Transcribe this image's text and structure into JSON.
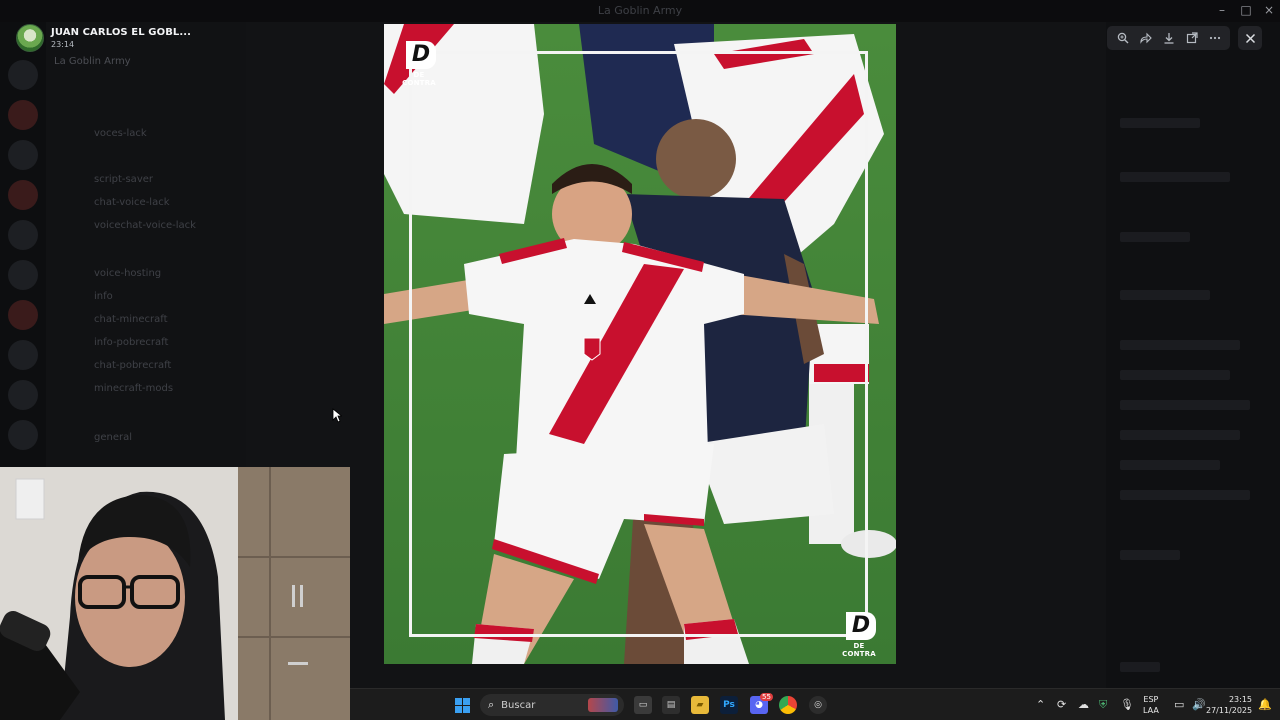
{
  "window": {
    "title": "La Goblin Army"
  },
  "viewer": {
    "user_name": "JUAN CARLOS EL GOBL...",
    "timestamp": "23:14"
  },
  "toolbar": {
    "zoom_icon": "zoom-in-icon",
    "forward_icon": "forward-icon",
    "download_icon": "download-icon",
    "open_icon": "open-in-browser-icon",
    "more_icon": "more-icon",
    "close_icon": "close-icon"
  },
  "background": {
    "guild_name": "La Goblin Army",
    "channels": [
      "voces-lack",
      "script-saver",
      "chat-voice-lack",
      "voicechat-voice-lack",
      "voice-hosting",
      "info",
      "chat-minecraft",
      "info-pobrecraft",
      "chat-pobrecraft",
      "minecraft-mods",
      "general"
    ]
  },
  "media": {
    "watermark": "DE CONTRA",
    "watermark_letter": "D"
  },
  "taskbar": {
    "search_placeholder": "Buscar",
    "language_line1": "ESP",
    "language_line2": "LAA",
    "time": "23:15",
    "date": "27/11/2025",
    "badge_count": "55"
  },
  "colors": {
    "accent_blue": "#3aa0f2",
    "peru_red": "#c8102e",
    "pitch_green": "#3e7f34"
  }
}
